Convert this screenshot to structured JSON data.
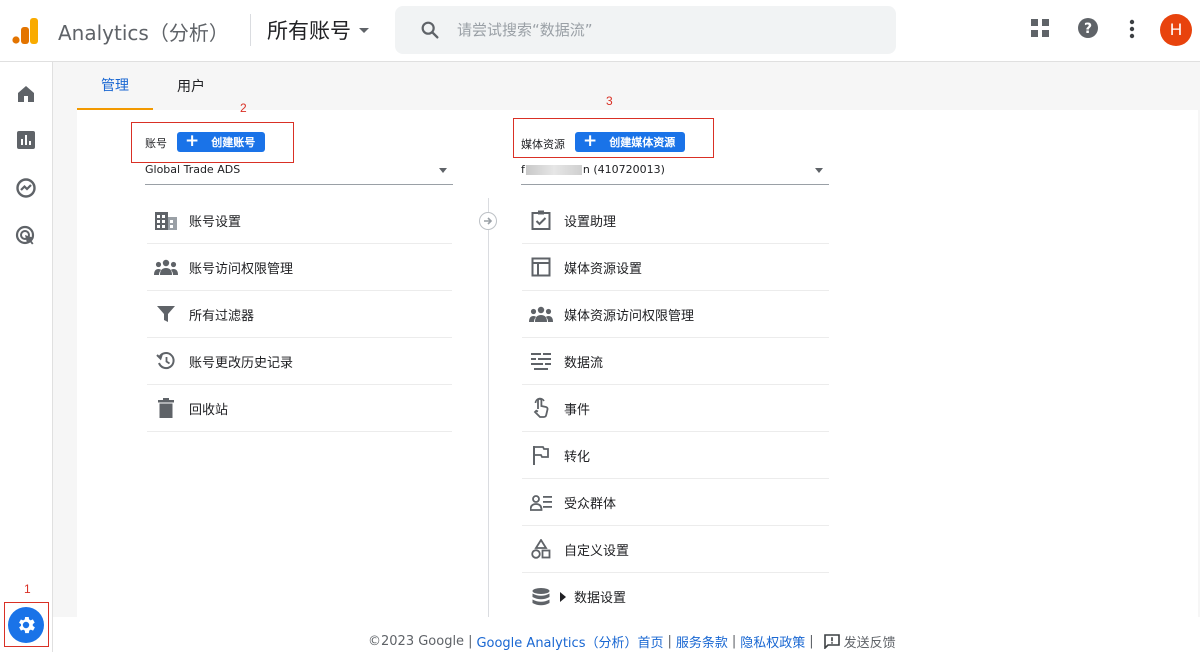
{
  "header": {
    "app_name": "Analytics（分析）",
    "account_switcher": "所有账号",
    "search_placeholder": "请尝试搜索“数据流”",
    "avatar_letter": "H"
  },
  "tabs": [
    {
      "label": "管理",
      "active": true
    },
    {
      "label": "用户",
      "active": false
    }
  ],
  "annotations": {
    "rail_gear": "1",
    "account_box": "2",
    "property_box": "3"
  },
  "account_column": {
    "label": "账号",
    "create_button": "创建账号",
    "selected": "Global Trade ADS",
    "items": [
      {
        "label": "账号设置",
        "icon": "building-icon"
      },
      {
        "label": "账号访问权限管理",
        "icon": "people-icon"
      },
      {
        "label": "所有过滤器",
        "icon": "filter-icon"
      },
      {
        "label": "账号更改历史记录",
        "icon": "history-icon"
      },
      {
        "label": "回收站",
        "icon": "trash-icon"
      }
    ]
  },
  "property_column": {
    "label": "媒体资源",
    "create_button": "创建媒体资源",
    "selected_prefix": "f",
    "selected_suffix": "n (410720013)",
    "items": [
      {
        "label": "设置助理",
        "icon": "checkbox-icon"
      },
      {
        "label": "媒体资源设置",
        "icon": "layout-icon"
      },
      {
        "label": "媒体资源访问权限管理",
        "icon": "people-icon"
      },
      {
        "label": "数据流",
        "icon": "streams-icon"
      },
      {
        "label": "事件",
        "icon": "touch-icon"
      },
      {
        "label": "转化",
        "icon": "flag-icon"
      },
      {
        "label": "受众群体",
        "icon": "audience-icon"
      },
      {
        "label": "自定义设置",
        "icon": "shapes-icon"
      },
      {
        "label": "数据设置",
        "icon": "database-icon"
      }
    ]
  },
  "footer": {
    "copyright": "©2023 Google",
    "links": [
      "Google Analytics（分析）首页",
      "服务条款",
      "隐私权政策"
    ],
    "separator": "|",
    "feedback": "发送反馈"
  },
  "colors": {
    "accent": "#1a73e8",
    "tab_underline": "#f29900",
    "annotation": "#d93025",
    "avatar": "#e8430d"
  }
}
